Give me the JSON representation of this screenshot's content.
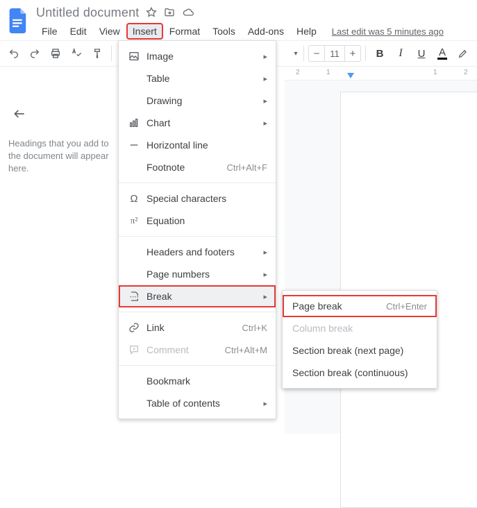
{
  "title": "Untitled document",
  "menubar": {
    "file": "File",
    "edit": "Edit",
    "view": "View",
    "insert": "Insert",
    "format": "Format",
    "tools": "Tools",
    "addons": "Add-ons",
    "help": "Help",
    "last_edit": "Last edit was 5 minutes ago"
  },
  "toolbar": {
    "font_size": "11"
  },
  "sidebar": {
    "outline_hint": "Headings that you add to the document will appear here."
  },
  "ruler": {
    "t1": "2",
    "t2": "1",
    "t3": "1",
    "t4": "2"
  },
  "insert_menu": {
    "image": "Image",
    "table": "Table",
    "drawing": "Drawing",
    "chart": "Chart",
    "hrule": "Horizontal line",
    "footnote": "Footnote",
    "footnote_sc": "Ctrl+Alt+F",
    "special": "Special characters",
    "equation": "Equation",
    "headers": "Headers and footers",
    "pagenums": "Page numbers",
    "break": "Break",
    "link": "Link",
    "link_sc": "Ctrl+K",
    "comment": "Comment",
    "comment_sc": "Ctrl+Alt+M",
    "bookmark": "Bookmark",
    "toc": "Table of contents"
  },
  "break_menu": {
    "page": "Page break",
    "page_sc": "Ctrl+Enter",
    "column": "Column break",
    "section_next": "Section break (next page)",
    "section_cont": "Section break (continuous)"
  }
}
